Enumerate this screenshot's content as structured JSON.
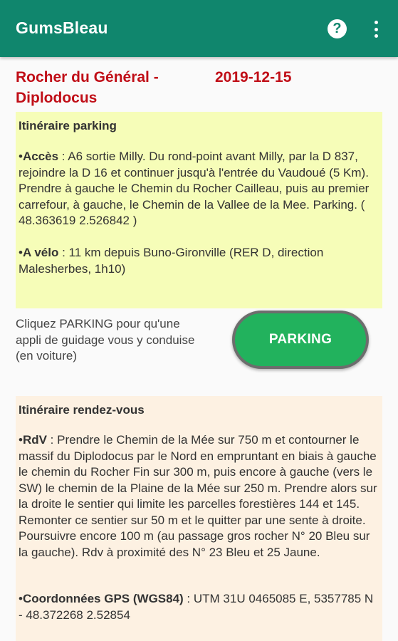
{
  "app": {
    "title": "GumsBleau",
    "help_glyph": "?",
    "colors": {
      "appbar": "#10866d",
      "title_red": "#c00e17",
      "parking_bg": "#f6fdb8",
      "rdv_bg": "#fdf1e2",
      "button_green": "#22b25d"
    }
  },
  "site": {
    "name": "Rocher du Général - Diplodocus",
    "date": "2019-12-15"
  },
  "parking_section": {
    "title": "Itinéraire parking",
    "acces_label": "Accès",
    "acces_text": " : A6 sortie Milly. Du rond-point avant Milly, par la D 837, rejoindre la D 16 et continuer jusqu'à l'entrée du Vaudoué (5 Km). Prendre à gauche le Chemin du Rocher Cailleau, puis au premier carrefour, à gauche, le Chemin de la Vallee de la Mee. Parking. ( 48.363619 2.526842 )",
    "velo_label": "A vélo",
    "velo_text": " : 11 km depuis Buno-Gironville (RER D, direction Malesherbes, 1h10)"
  },
  "parking_action": {
    "hint": "Cliquez PARKING pour qu'une appli de guidage vous y conduise (en voiture)",
    "button_label": "PARKING"
  },
  "rdv_section": {
    "title": "Itinéraire rendez-vous",
    "rdv_label": "RdV",
    "rdv_text": " : Prendre le Chemin de la Mée sur 750 m et contourner le massif du Diplodocus par le Nord en empruntant en biais à gauche le chemin du Rocher Fin sur 300 m, puis encore à gauche (vers le SW) le chemin de la Plaine de la Mée sur 250 m. Prendre alors sur la droite le sentier qui limite les parcelles forestières 144 et 145. Remonter ce sentier sur 50 m et le quitter par une sente à droite. Poursuivre encore 100 m (au passage gros rocher N° 20 Bleu sur la gauche). Rdv à proximité des N° 23 Bleu et 25 Jaune.",
    "gps_label": "Coordonnées GPS (WGS84)",
    "gps_text": " : UTM 31U 0465085 E, 5357785 N - 48.372268 2.52854"
  }
}
